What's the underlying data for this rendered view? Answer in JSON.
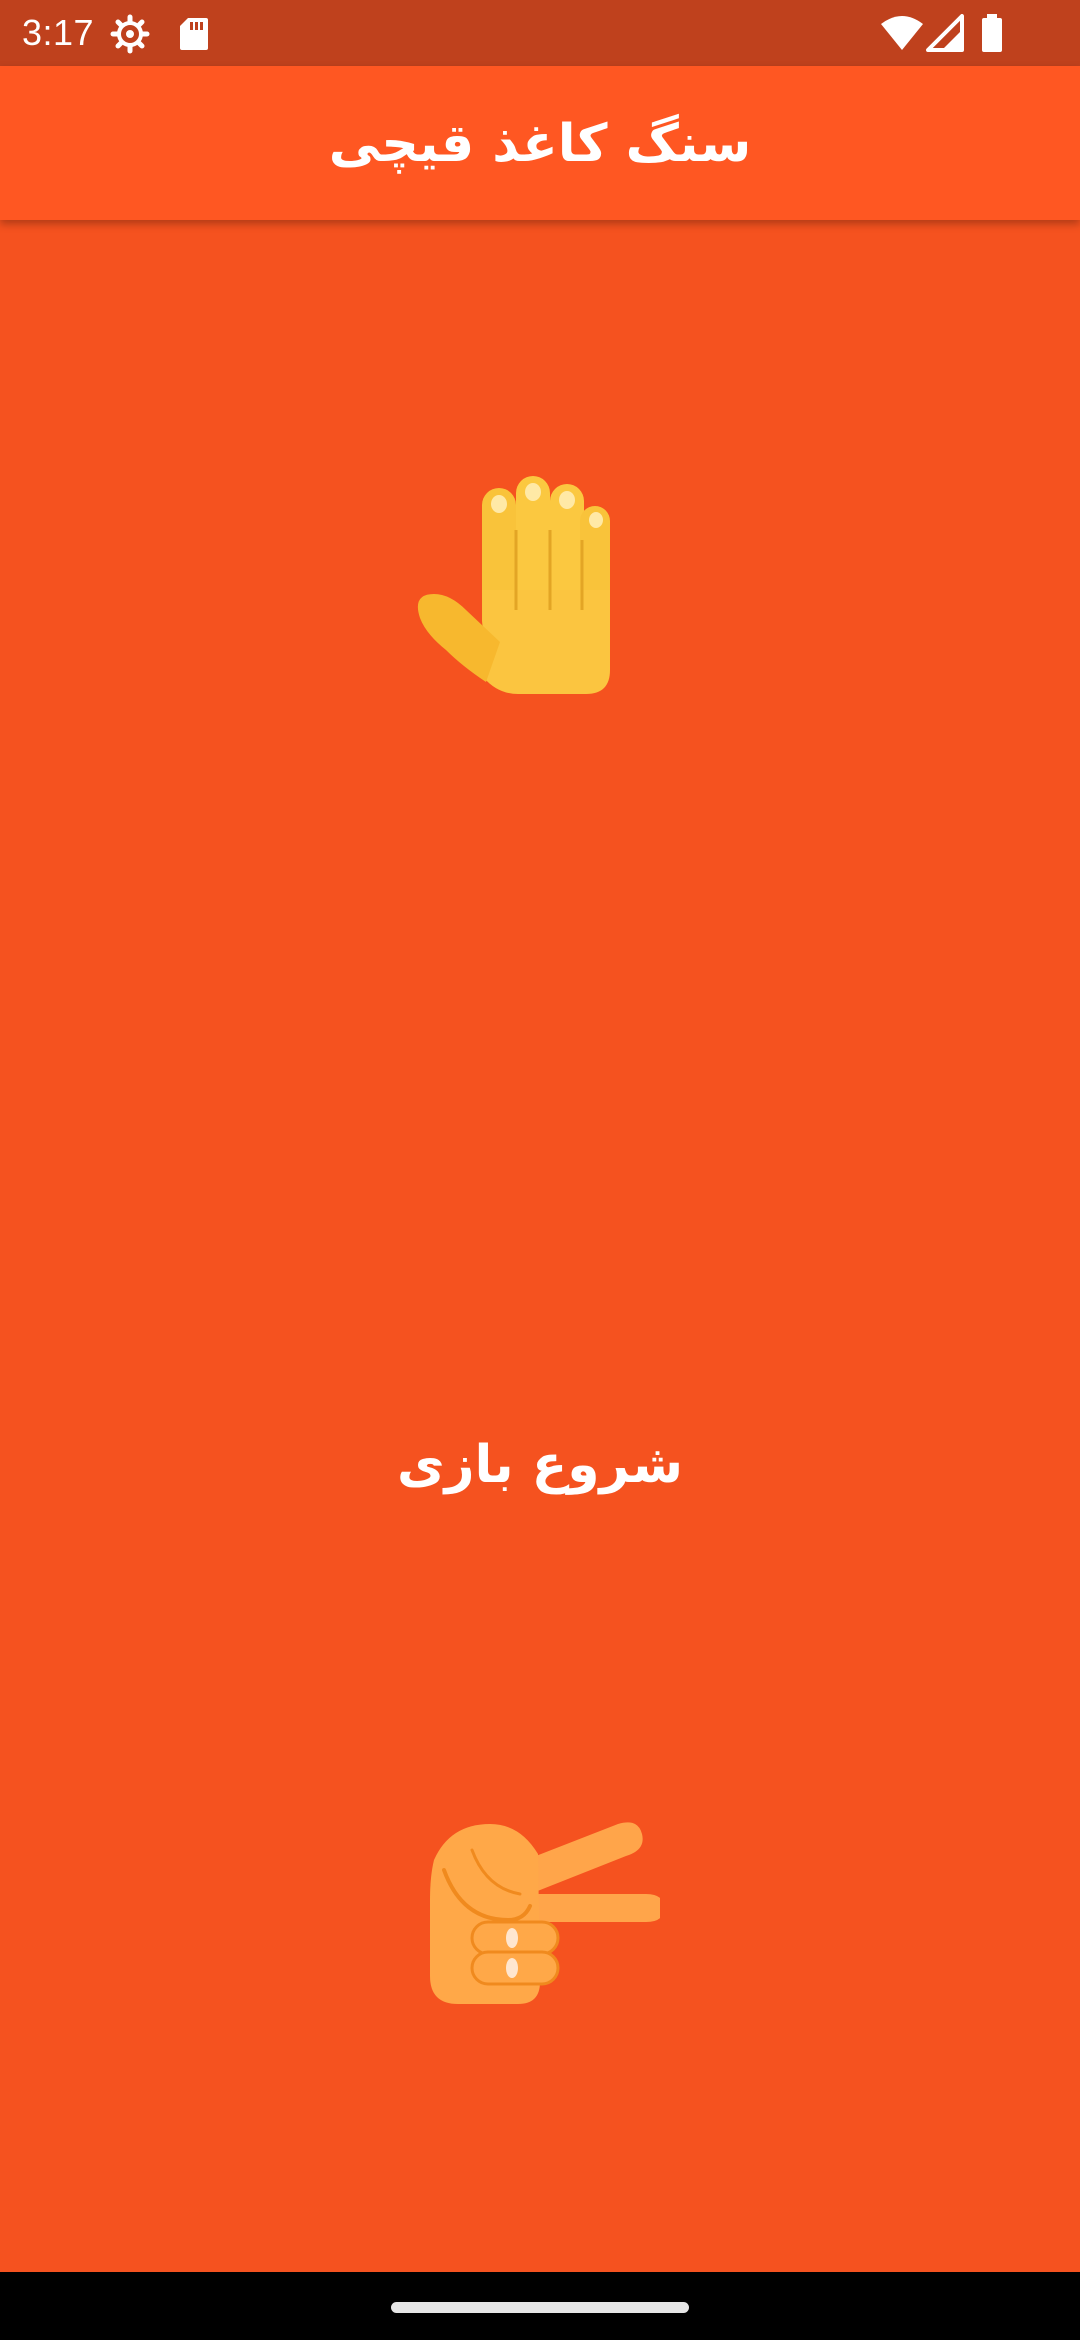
{
  "status_bar": {
    "time": "3:17",
    "icons": [
      "settings-gear-icon",
      "sd-card-icon",
      "wifi-icon",
      "cell-signal-icon",
      "battery-icon"
    ]
  },
  "app_bar": {
    "title": "سنگ  کاغذ  قیچی"
  },
  "main": {
    "top_hand": "raised-hand-icon",
    "start_label": "شروع بازی",
    "bottom_hand": "victory-hand-icon"
  },
  "nav_bar": {
    "icons": [
      "home-gesture-pill"
    ]
  },
  "colors": {
    "background": "#F5521F",
    "app_bar": "#FF5722",
    "status_bar": "#BF411D"
  }
}
